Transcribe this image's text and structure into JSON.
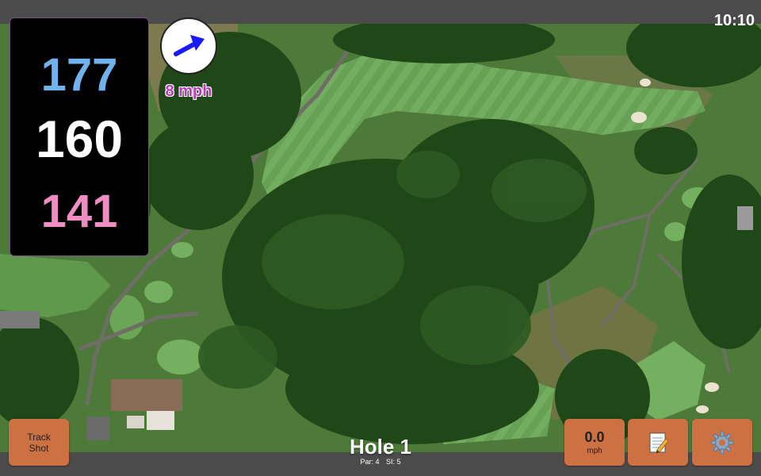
{
  "status": {
    "time": "10:10"
  },
  "distances": {
    "back": "177",
    "middle": "160",
    "front": "141",
    "colors": {
      "back": "#6fb2ee",
      "middle": "#ffffff",
      "front": "#f08cc4"
    }
  },
  "wind": {
    "speed": "8 mph",
    "arrow_icon": "wind-direction-arrow-icon",
    "arrow_color": "#1a1aff"
  },
  "buttons": {
    "track_shot": {
      "line1": "Track",
      "line2": "Shot"
    },
    "speed": {
      "value": "0.0",
      "unit": "mph"
    },
    "notes_icon": "notepad-icon",
    "settings_icon": "gear-icon"
  },
  "hole": {
    "title": "Hole 1",
    "par": "Par: 4",
    "si": "SI: 5"
  },
  "map": {
    "type": "satellite",
    "fairway_color": "#6fa85a",
    "tree_color": "#1e4416",
    "rough_color": "#4d7a38"
  }
}
